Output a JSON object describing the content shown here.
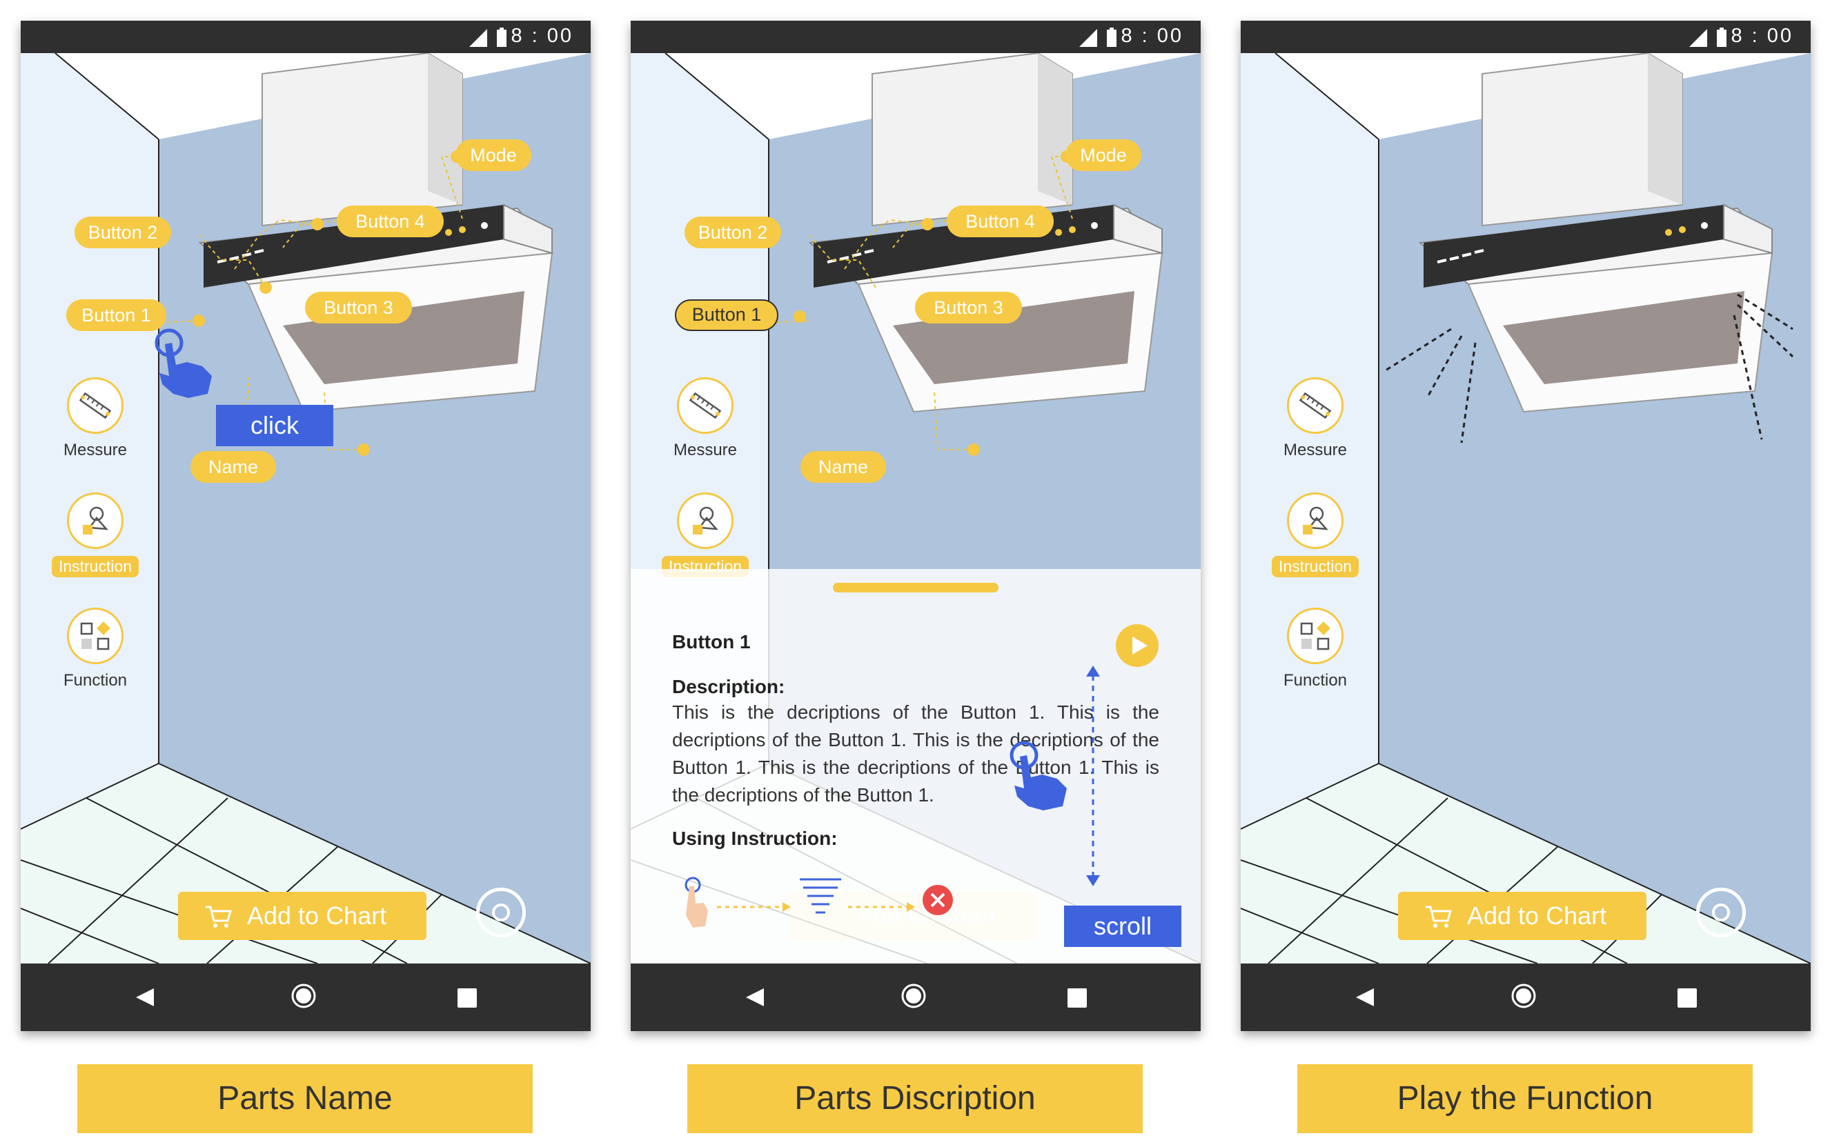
{
  "status": {
    "time": "8 : 00"
  },
  "parts": {
    "button1": "Button 1",
    "button2": "Button 2",
    "button3": "Button 3",
    "button4": "Button 4",
    "mode": "Mode",
    "name": "Name"
  },
  "side_menu": {
    "measure": "Messure",
    "instruction": "Instruction",
    "function": "Function"
  },
  "add_to_cart": "Add to Chart",
  "gestures": {
    "click": "click",
    "scroll": "scroll"
  },
  "sheet": {
    "title": "Button 1",
    "description_heading": "Description:",
    "description": "This is the decriptions of the Button 1. This is the decriptions of the Button 1. This is the decriptions of the Button 1. This is the decriptions of the Button 1. This is the decriptions of the Button 1.",
    "using_heading": "Using Instruction:"
  },
  "captions": {
    "panel1": "Parts Name",
    "panel2": "Parts Discription",
    "panel3": "Play the Function"
  },
  "colors": {
    "accent": "#f7ca45",
    "wall": "#aec3dc",
    "highlight": "#3e63dd",
    "bar": "#2f2f2f"
  }
}
